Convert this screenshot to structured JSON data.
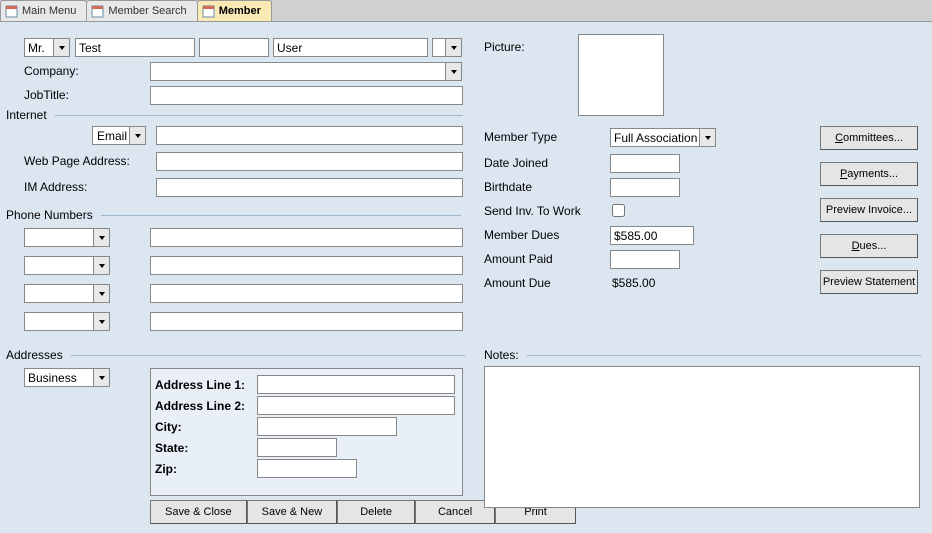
{
  "tabs": [
    {
      "label": "Main Menu",
      "active": false
    },
    {
      "label": "Member Search",
      "active": false
    },
    {
      "label": "Member",
      "active": true
    }
  ],
  "name": {
    "prefix": "Mr.",
    "first": "Test",
    "middle": "",
    "last": "User",
    "suffix": ""
  },
  "labels": {
    "company": "Company:",
    "jobtitle": "JobTitle:",
    "internet": "Internet",
    "email": "Email",
    "webpage": "Web Page Address:",
    "im": "IM Address:",
    "phonenumbers": "Phone Numbers",
    "addresses": "Addresses",
    "addr1": "Address Line 1:",
    "addr2": "Address Line 2:",
    "city": "City:",
    "state": "State:",
    "zip": "Zip:",
    "picture": "Picture:",
    "membertype": "Member Type",
    "datejoined": "Date Joined",
    "birthdate": "Birthdate",
    "sendinvwork": "Send Inv. To Work",
    "memberdues": "Member Dues",
    "amountpaid": "Amount Paid",
    "amountdue": "Amount Due",
    "notes": "Notes:"
  },
  "values": {
    "company": "",
    "jobtitle": "",
    "email": "",
    "webpage": "",
    "im": "",
    "phone_types": [
      "",
      "",
      "",
      ""
    ],
    "phone_values": [
      "",
      "",
      "",
      ""
    ],
    "address_type": "Business",
    "addr1": "",
    "addr2": "",
    "city": "",
    "state": "",
    "zip": "",
    "membertype": "Full Association",
    "datejoined": "",
    "birthdate": "",
    "sendinvwork": false,
    "memberdues": "$585.00",
    "amountpaid": "",
    "amountdue": "$585.00",
    "notes": ""
  },
  "action_buttons": {
    "committees": {
      "u": "C",
      "rest": "ommittees..."
    },
    "payments": {
      "u": "P",
      "rest": "ayments..."
    },
    "preview_invoice": {
      "text": "Preview Invoice..."
    },
    "dues": {
      "u": "D",
      "rest": "ues..."
    },
    "preview_statement": {
      "text": "Preview Statement"
    }
  },
  "bottom_buttons": [
    "Save & Close",
    "Save & New",
    "Delete",
    "Cancel",
    "Print"
  ]
}
